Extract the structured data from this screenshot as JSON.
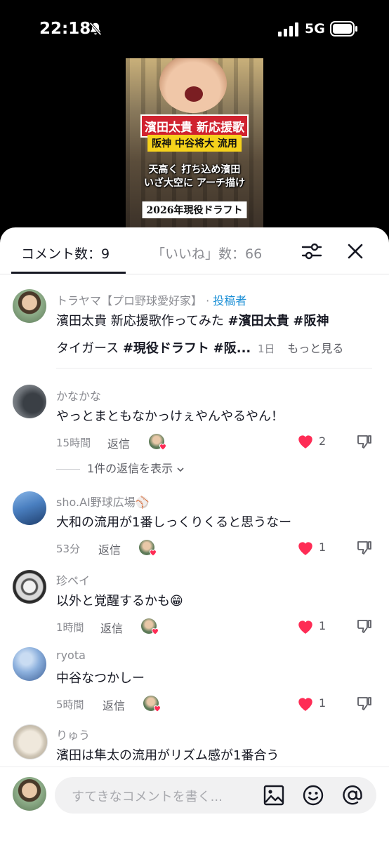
{
  "status": {
    "time": "22:18",
    "network": "5G"
  },
  "video": {
    "caption1": "濱田太貴 新応援歌",
    "caption2": "阪神 中谷将大 流用",
    "caption3a": "天高く 打ち込め濱田",
    "caption3b": "いざ大空に アーチ描け",
    "caption4": "2026年現役ドラフト"
  },
  "tabs": {
    "comments": "コメント数：9",
    "likes": "「いいね」数：66"
  },
  "author_post": {
    "username": "トラヤマ【プロ野球愛好家】",
    "sep": " · ",
    "author_label": "投稿者",
    "line1_text": "濱田太貴 新応援歌作ってみた ",
    "tag1": "#濱田太貴",
    "tag2": "#阪神",
    "line2_text": "タイガース ",
    "tag3": "#現役ドラフト",
    "tag4": "#阪...",
    "time": "1日",
    "more": "もっと見る"
  },
  "comments": [
    {
      "username": "かなかな",
      "text": "やっとまともなかっけぇやんやるやん！",
      "time": "15時間",
      "reply": "返信",
      "likes": "2",
      "liked": true
    },
    {
      "username": "sho.AI野球広場⚾",
      "text": "大和の流用が1番しっくりくると思うなー",
      "time": "53分",
      "reply": "返信",
      "likes": "1",
      "liked": true
    },
    {
      "username": "珍ペイ",
      "text": "以外と覚醒するかも😁",
      "time": "1時間",
      "reply": "返信",
      "likes": "1",
      "liked": true
    },
    {
      "username": "ryota",
      "text": "中谷なつかしー",
      "time": "5時間",
      "reply": "返信",
      "likes": "1",
      "liked": true
    },
    {
      "username": "りゅう",
      "text": "濱田は隼太の流用がリズム感が1番合う"
    }
  ],
  "show_replies": "1件の返信を表示",
  "input": {
    "placeholder": "すてきなコメントを書く..."
  },
  "colors": {
    "heart": "#fe2c55",
    "author_tag": "#1b8fd6",
    "text": "#161823",
    "muted": "#8a8b91"
  },
  "icons": [
    "bell-slash-icon",
    "signal-icon",
    "battery-icon",
    "filter-icon",
    "close-icon",
    "heart-icon",
    "dislike-icon",
    "image-icon",
    "emoji-icon",
    "mention-icon",
    "chevron-down-icon"
  ]
}
